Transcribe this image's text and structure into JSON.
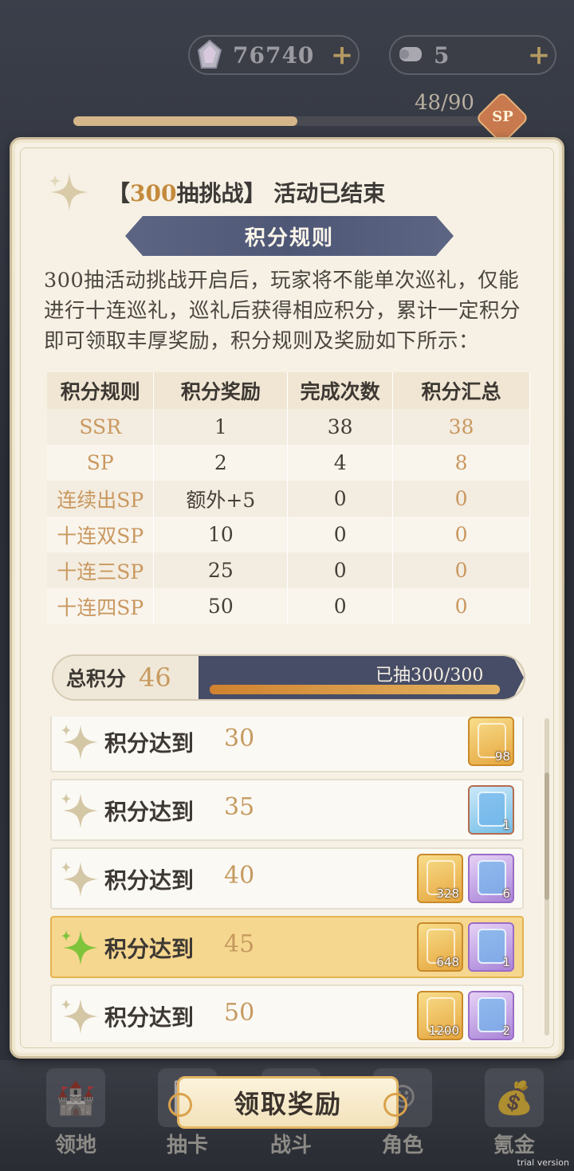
{
  "header": {
    "crystal_value": "76740",
    "scroll_value": "5",
    "plus_label": "+",
    "pity_progress": "48/90",
    "pity_fraction": 0.53,
    "sp_badge": "SP"
  },
  "dialog": {
    "title_prefix": "【",
    "title_accent": "300",
    "title_rest": "抽挑战】 活动已结束",
    "section_banner": "积分规则",
    "description": "300抽活动挑战开启后，玩家将不能单次巡礼，仅能进行十连巡礼，巡礼后获得相应积分，累计一定积分即可领取丰厚奖励，积分规则及奖励如下所示：",
    "table": {
      "headers": [
        "积分规则",
        "积分奖励",
        "完成次数",
        "积分汇总"
      ],
      "rows": [
        [
          "SSR",
          "1",
          "38",
          "38"
        ],
        [
          "SP",
          "2",
          "4",
          "8"
        ],
        [
          "连续出SP",
          "额外+5",
          "0",
          "0"
        ],
        [
          "十连双SP",
          "10",
          "0",
          "0"
        ],
        [
          "十连三SP",
          "25",
          "0",
          "0"
        ],
        [
          "十连四SP",
          "50",
          "0",
          "0"
        ]
      ]
    },
    "total": {
      "label": "总积分",
      "value": "46",
      "drawn": "已抽300/300",
      "drawn_fraction": 1.0
    },
    "rewards": [
      {
        "label": "积分达到",
        "points": "30",
        "items": [
          {
            "kind": "gold",
            "count": "98"
          }
        ]
      },
      {
        "label": "积分达到",
        "points": "35",
        "items": [
          {
            "kind": "blue",
            "count": "1"
          }
        ]
      },
      {
        "label": "积分达到",
        "points": "40",
        "items": [
          {
            "kind": "gold",
            "count": "328"
          },
          {
            "kind": "purple",
            "count": "6"
          }
        ]
      },
      {
        "label": "积分达到",
        "points": "45",
        "items": [
          {
            "kind": "gold",
            "count": "648"
          },
          {
            "kind": "purple",
            "count": "1"
          }
        ],
        "active": true
      },
      {
        "label": "积分达到",
        "points": "50",
        "items": [
          {
            "kind": "gold",
            "count": "1200"
          },
          {
            "kind": "purple",
            "count": "2"
          }
        ]
      }
    ]
  },
  "claim_button": "领取奖励",
  "nav": [
    "领地",
    "抽卡",
    "战斗",
    "角色",
    "氪金"
  ],
  "watermark": "trial version",
  "colors": {
    "accent": "#c99860",
    "banner": "#4f5776",
    "active_row": "#f6d78f"
  }
}
